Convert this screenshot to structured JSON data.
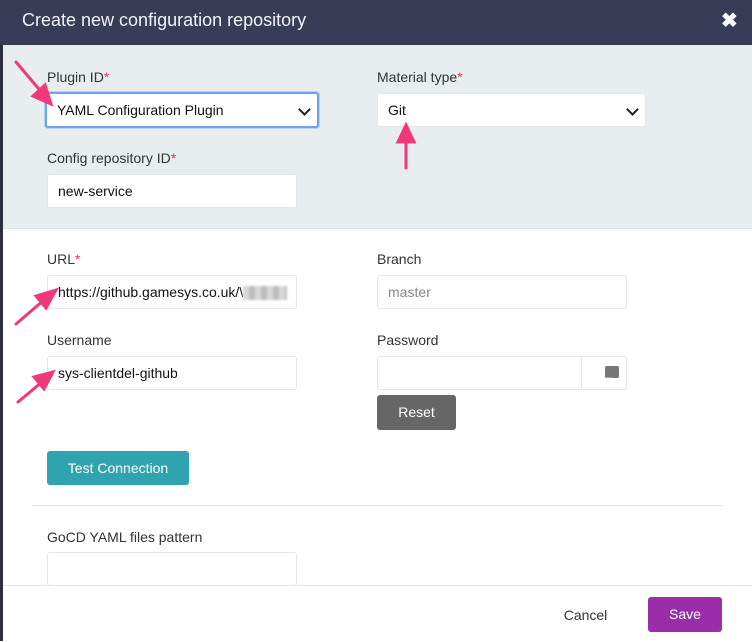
{
  "dialog": {
    "title": "Create new configuration repository",
    "close_glyph": "✖"
  },
  "required_mark": "*",
  "form": {
    "plugin_id": {
      "label": "Plugin ID",
      "value": "YAML Configuration Plugin"
    },
    "material_type": {
      "label": "Material type",
      "value": "Git"
    },
    "config_repo_id": {
      "label": "Config repository ID",
      "value": "new-service"
    },
    "url": {
      "label": "URL",
      "value": "https://github.gamesys.co.uk/\\"
    },
    "branch": {
      "label": "Branch",
      "placeholder": "master"
    },
    "username": {
      "label": "Username",
      "value": "sys-clientdel-github"
    },
    "password": {
      "label": "Password",
      "value": ""
    },
    "yaml_pattern": {
      "label": "GoCD YAML files pattern",
      "value": ""
    }
  },
  "buttons": {
    "reset": "Reset",
    "test_connection": "Test Connection",
    "cancel": "Cancel",
    "save": "Save"
  },
  "colors": {
    "header_bg": "#373c57",
    "panel_bg": "#e8eef0",
    "required": "#e0394a",
    "test_button": "#2fa3ae",
    "save_button": "#9b2ea8",
    "reset_button": "#666666",
    "annotation_arrow": "#f0397a"
  }
}
